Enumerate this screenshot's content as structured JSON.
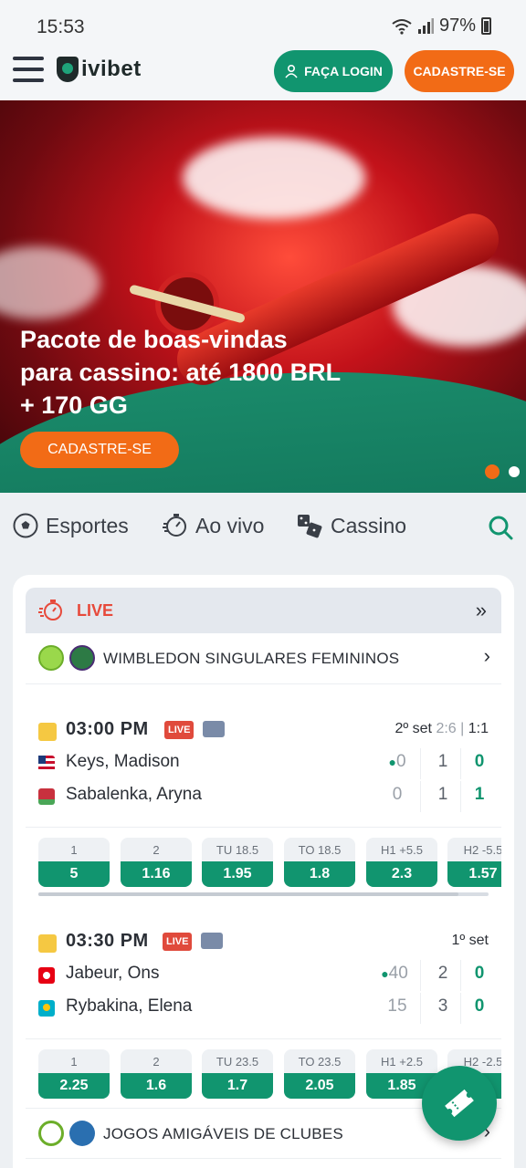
{
  "status_bar": {
    "time": "15:53",
    "battery": "97%"
  },
  "header": {
    "logo_text": "ivibet",
    "login_label": "FAÇA LOGIN",
    "signup_label": "CADASTRE-SE"
  },
  "banner": {
    "headline_line1": "Pacote de boas-vindas",
    "headline_line2": "para cassino: até 1800 BRL",
    "headline_line3": "+ 170 GG",
    "cta_label": "CADASTRE-SE",
    "active_dot_color": "#f26b16"
  },
  "nav": {
    "items": [
      {
        "label": "Esportes",
        "icon": "soccer-ball-icon"
      },
      {
        "label": "Ao vivo",
        "icon": "stopwatch-icon"
      },
      {
        "label": "Cassino",
        "icon": "dice-icon"
      }
    ],
    "search_icon": "search-icon"
  },
  "live_section": {
    "label": "LIVE",
    "leagues": [
      {
        "name": "WIMBLEDON SINGULARES FEMININOS"
      },
      {
        "name": "JOGOS AMIGÁVEIS DE CLUBES"
      }
    ],
    "matches": [
      {
        "time": "03:00 PM",
        "badge": "LIVE",
        "set_label": "2º set",
        "set_score": "2:6",
        "set_divider": "|",
        "set_games": "1:1",
        "teams": [
          {
            "name": "Keys, Madison",
            "flag": "us-flag",
            "points": "0",
            "sets": "1",
            "games": "0",
            "serving": true
          },
          {
            "name": "Sabalenka, Aryna",
            "flag": "by-flag",
            "points": "0",
            "sets": "1",
            "games": "1",
            "serving": false
          }
        ],
        "odds": [
          {
            "label": "1",
            "value": "5"
          },
          {
            "label": "2",
            "value": "1.16"
          },
          {
            "label": "TU 18.5",
            "value": "1.95"
          },
          {
            "label": "TO 18.5",
            "value": "1.8"
          },
          {
            "label": "H1 +5.5",
            "value": "2.3"
          },
          {
            "label": "H2 -5.5",
            "value": "1.57"
          }
        ]
      },
      {
        "time": "03:30 PM",
        "badge": "LIVE",
        "set_label": "1º set",
        "teams": [
          {
            "name": "Jabeur, Ons",
            "flag": "tn-flag",
            "points": "40",
            "sets": "2",
            "games": "0",
            "serving": true
          },
          {
            "name": "Rybakina, Elena",
            "flag": "kz-flag",
            "points": "15",
            "sets": "3",
            "games": "0",
            "serving": false
          }
        ],
        "odds": [
          {
            "label": "1",
            "value": "2.25"
          },
          {
            "label": "2",
            "value": "1.6"
          },
          {
            "label": "TU 23.5",
            "value": "1.7"
          },
          {
            "label": "TO 23.5",
            "value": "2.05"
          },
          {
            "label": "H1 +2.5",
            "value": "1.85"
          },
          {
            "label": "H2 -2.5",
            "value": ""
          }
        ]
      }
    ]
  },
  "colors": {
    "brand_green": "#11956f",
    "brand_orange": "#f26b16",
    "live_red": "#e74a3b"
  }
}
